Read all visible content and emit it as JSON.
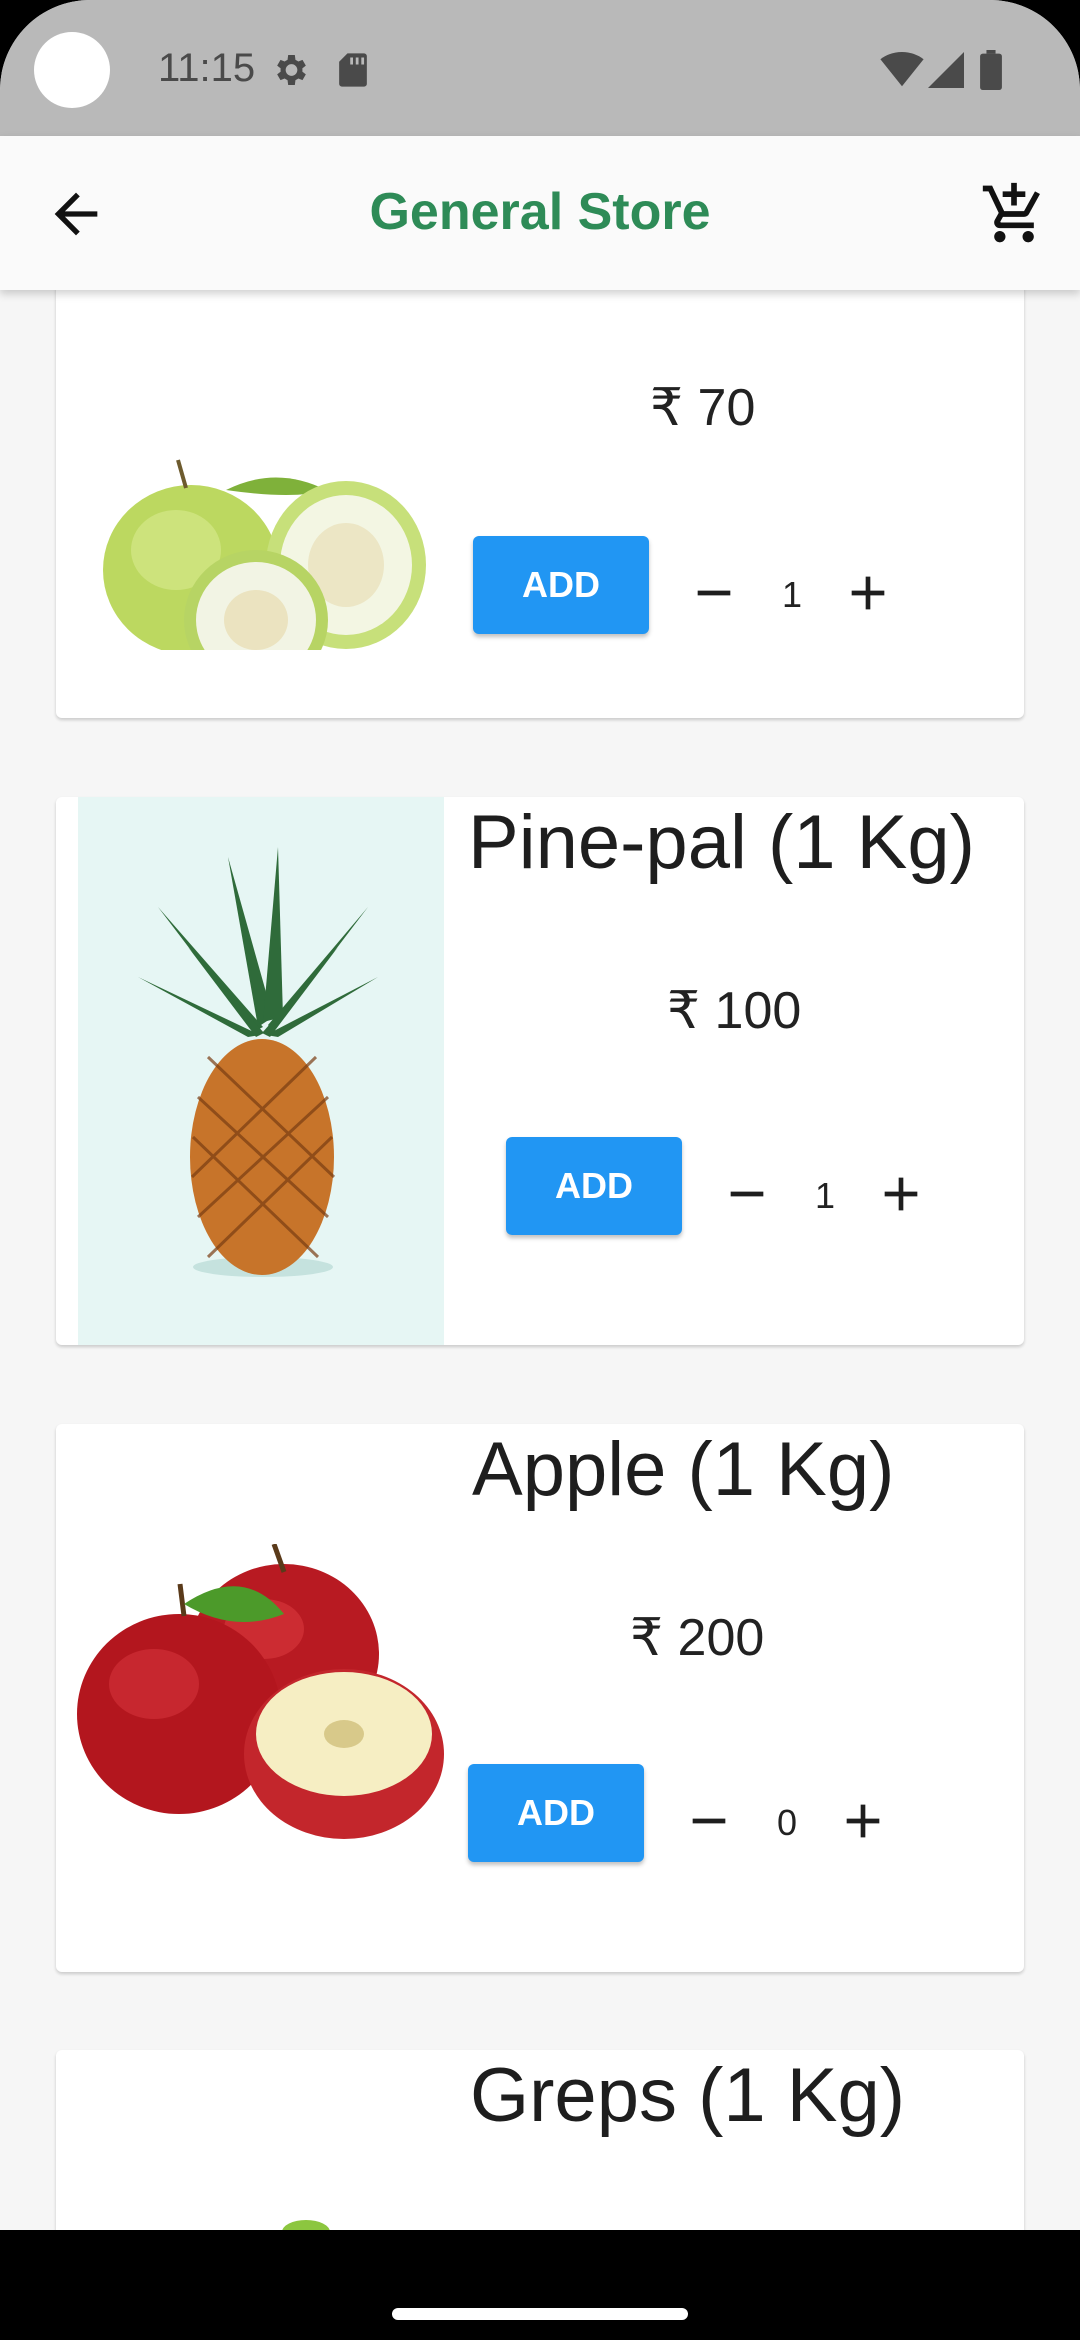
{
  "status_bar": {
    "time": "11:15"
  },
  "app_bar": {
    "title": "General Store"
  },
  "products": [
    {
      "name": "",
      "price": "₹ 70",
      "add_label": "ADD",
      "quantity": "1"
    },
    {
      "name": "Pine-pal (1 Kg)",
      "price": "₹ 100",
      "add_label": "ADD",
      "quantity": "1"
    },
    {
      "name": "Apple (1 Kg)",
      "price": "₹ 200",
      "add_label": "ADD",
      "quantity": "0"
    },
    {
      "name": "Greps (1 Kg)"
    }
  ],
  "colors": {
    "accent": "#2196f3",
    "title": "#2e8b57",
    "status_bar": "#b9b9b9"
  },
  "icons": [
    "back-arrow-icon",
    "add-to-cart-icon",
    "minus-icon",
    "plus-icon",
    "settings-icon",
    "sd-card-icon",
    "wifi-icon",
    "signal-icon",
    "battery-icon"
  ]
}
